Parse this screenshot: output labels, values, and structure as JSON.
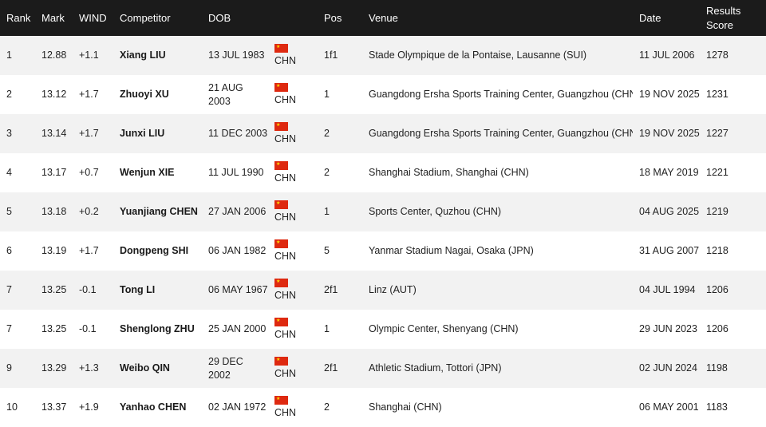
{
  "headers": {
    "rank": "Rank",
    "mark": "Mark",
    "wind": "WIND",
    "competitor": "Competitor",
    "dob": "DOB",
    "nat": "",
    "pos": "Pos",
    "venue": "Venue",
    "date": "Date",
    "score": "Results Score"
  },
  "colors": {
    "header_bg": "#1b1b1b",
    "flag_red": "#de2910",
    "flag_star": "#ffde00"
  },
  "icons": {
    "flag": "china-flag-icon"
  },
  "rows": [
    {
      "rank": "1",
      "mark": "12.88",
      "wind": "+1.1",
      "competitor": "Xiang LIU",
      "dob": "13 JUL 1983",
      "nat": "CHN",
      "pos": "1f1",
      "venue": "Stade Olympique de la Pontaise, Lausanne (SUI)",
      "date": "11 JUL 2006",
      "score": "1278"
    },
    {
      "rank": "2",
      "mark": "13.12",
      "wind": "+1.7",
      "competitor": "Zhuoyi XU",
      "dob": "21 AUG 2003",
      "nat": "CHN",
      "pos": "1",
      "venue": "Guangdong Ersha Sports Training Center, Guangzhou (CHN)",
      "date": "19 NOV 2025",
      "score": "1231"
    },
    {
      "rank": "3",
      "mark": "13.14",
      "wind": "+1.7",
      "competitor": "Junxi LIU",
      "dob": "11 DEC 2003",
      "nat": "CHN",
      "pos": "2",
      "venue": "Guangdong Ersha Sports Training Center, Guangzhou (CHN)",
      "date": "19 NOV 2025",
      "score": "1227"
    },
    {
      "rank": "4",
      "mark": "13.17",
      "wind": "+0.7",
      "competitor": "Wenjun XIE",
      "dob": "11 JUL 1990",
      "nat": "CHN",
      "pos": "2",
      "venue": "Shanghai Stadium, Shanghai (CHN)",
      "date": "18 MAY 2019",
      "score": "1221"
    },
    {
      "rank": "5",
      "mark": "13.18",
      "wind": "+0.2",
      "competitor": "Yuanjiang CHEN",
      "dob": "27 JAN 2006",
      "nat": "CHN",
      "pos": "1",
      "venue": "Sports Center, Quzhou (CHN)",
      "date": "04 AUG 2025",
      "score": "1219"
    },
    {
      "rank": "6",
      "mark": "13.19",
      "wind": "+1.7",
      "competitor": "Dongpeng SHI",
      "dob": "06 JAN 1982",
      "nat": "CHN",
      "pos": "5",
      "venue": "Yanmar Stadium Nagai, Osaka (JPN)",
      "date": "31 AUG 2007",
      "score": "1218"
    },
    {
      "rank": "7",
      "mark": "13.25",
      "wind": "-0.1",
      "competitor": "Tong LI",
      "dob": "06 MAY 1967",
      "nat": "CHN",
      "pos": "2f1",
      "venue": "Linz (AUT)",
      "date": "04 JUL 1994",
      "score": "1206"
    },
    {
      "rank": "7",
      "mark": "13.25",
      "wind": "-0.1",
      "competitor": "Shenglong ZHU",
      "dob": "25 JAN 2000",
      "nat": "CHN",
      "pos": "1",
      "venue": "Olympic Center, Shenyang (CHN)",
      "date": "29 JUN 2023",
      "score": "1206"
    },
    {
      "rank": "9",
      "mark": "13.29",
      "wind": "+1.3",
      "competitor": "Weibo QIN",
      "dob": "29 DEC 2002",
      "nat": "CHN",
      "pos": "2f1",
      "venue": "Athletic Stadium, Tottori (JPN)",
      "date": "02 JUN 2024",
      "score": "1198"
    },
    {
      "rank": "10",
      "mark": "13.37",
      "wind": "+1.9",
      "competitor": "Yanhao CHEN",
      "dob": "02 JAN 1972",
      "nat": "CHN",
      "pos": "2",
      "venue": "Shanghai (CHN)",
      "date": "06 MAY 2001",
      "score": "1183"
    }
  ]
}
